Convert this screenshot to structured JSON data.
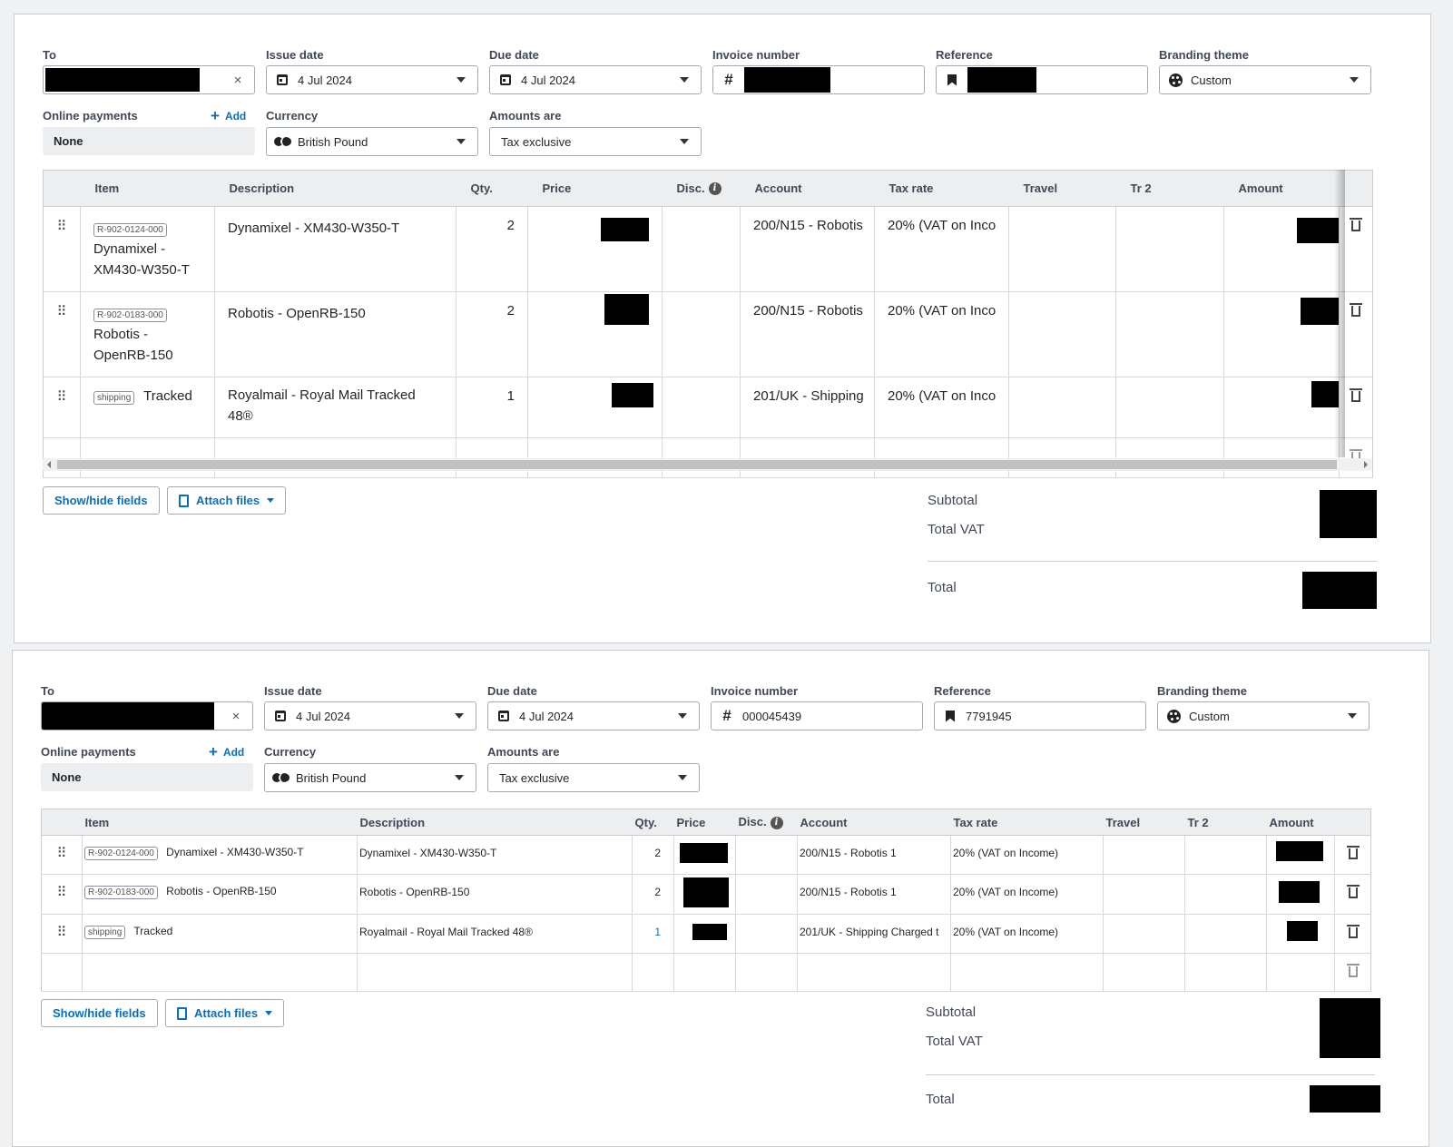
{
  "labels": {
    "to": "To",
    "issue_date": "Issue date",
    "due_date": "Due date",
    "invoice_number": "Invoice number",
    "reference": "Reference",
    "branding_theme": "Branding theme",
    "online_payments": "Online payments",
    "add": "Add",
    "currency": "Currency",
    "amounts_are": "Amounts are"
  },
  "columns": {
    "item": "Item",
    "description": "Description",
    "qty": "Qty.",
    "price": "Price",
    "disc": "Disc.",
    "account": "Account",
    "tax_rate": "Tax rate",
    "travel": "Travel",
    "tr2": "Tr 2",
    "amount": "Amount"
  },
  "buttons": {
    "show_hide_fields": "Show/hide fields",
    "attach_files": "Attach files"
  },
  "totals": {
    "subtotal": "Subtotal",
    "total_vat": "Total VAT",
    "total": "Total"
  },
  "invoice_a": {
    "issue_date": "4 Jul 2024",
    "due_date": "4 Jul 2024",
    "branding_theme": "Custom",
    "online_payments": "None",
    "currency": "British Pound",
    "amounts_are": "Tax exclusive",
    "rows": [
      {
        "tag": "R-902-0124-000",
        "item": "Dynamixel - XM430-W350-T",
        "description": "Dynamixel - XM430-W350-T",
        "qty": "2",
        "account": "200/N15 - Robotis",
        "tax": "20% (VAT on Inco"
      },
      {
        "tag": "R-902-0183-000",
        "item": "Robotis - OpenRB-150",
        "description": "Robotis - OpenRB-150",
        "qty": "2",
        "account": "200/N15 - Robotis",
        "tax": "20% (VAT on Inco"
      },
      {
        "tag": "shipping",
        "item": "Tracked",
        "description": "Royalmail - Royal Mail Tracked 48®",
        "qty": "1",
        "account": "201/UK - Shipping",
        "tax": "20% (VAT on Inco"
      }
    ]
  },
  "invoice_b": {
    "issue_date": "4 Jul 2024",
    "due_date": "4 Jul 2024",
    "invoice_number": "000045439",
    "reference": "7791945",
    "branding_theme": "Custom",
    "online_payments": "None",
    "currency": "British Pound",
    "amounts_are": "Tax exclusive",
    "rows": [
      {
        "tag": "R-902-0124-000",
        "item": "Dynamixel - XM430-W350-T",
        "description": "Dynamixel - XM430-W350-T",
        "qty": "2",
        "account": "200/N15 - Robotis 1",
        "tax": "20% (VAT on Income)"
      },
      {
        "tag": "R-902-0183-000",
        "item": "Robotis - OpenRB-150",
        "description": "Robotis - OpenRB-150",
        "qty": "2",
        "account": "200/N15 - Robotis 1",
        "tax": "20% (VAT on Income)"
      },
      {
        "tag": "shipping",
        "item": "Tracked",
        "description": "Royalmail - Royal Mail Tracked 48®",
        "qty": "1",
        "account": "201/UK - Shipping Charged t",
        "tax": "20% (VAT on Income)"
      }
    ]
  },
  "icons": {
    "drag": "drag-handle-icon",
    "trash": "trash-icon",
    "calendar": "calendar-icon",
    "hash": "hash-icon",
    "bookmark": "bookmark-icon",
    "palette": "palette-icon",
    "currency": "coins-icon",
    "clear": "close-icon",
    "document": "document-icon",
    "info": "info-icon"
  },
  "colors": {
    "accent": "#0a6ebd",
    "header_bg": "#eceef0",
    "redaction": "#000000"
  }
}
